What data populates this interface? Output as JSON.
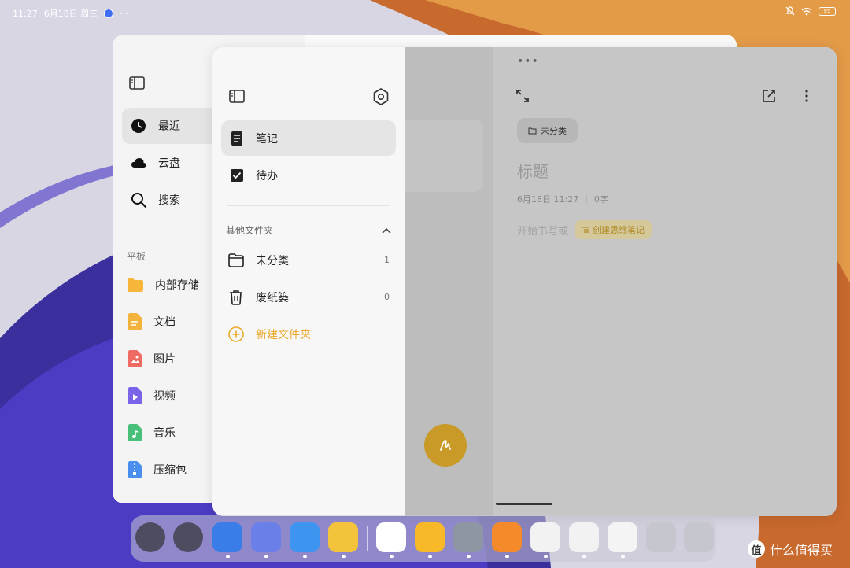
{
  "status_bar": {
    "time": "11:27",
    "date": "6月18日 周三",
    "more": "···",
    "battery": "95"
  },
  "files_app": {
    "nav": [
      {
        "label": "最近",
        "icon": "clock-icon",
        "active": true
      },
      {
        "label": "云盘",
        "icon": "cloud-icon",
        "active": false
      },
      {
        "label": "搜索",
        "icon": "search-icon",
        "active": false
      }
    ],
    "section_title": "平板",
    "types": [
      {
        "label": "内部存储",
        "icon": "folder-icon",
        "color": "#f5b63a"
      },
      {
        "label": "文档",
        "icon": "document-icon",
        "color": "#f3b23b"
      },
      {
        "label": "图片",
        "icon": "image-icon",
        "color": "#ef6a62"
      },
      {
        "label": "视频",
        "icon": "video-icon",
        "color": "#7a63e8"
      },
      {
        "label": "音乐",
        "icon": "music-icon",
        "color": "#49c07a"
      },
      {
        "label": "压缩包",
        "icon": "zip-icon",
        "color": "#4a8ef0"
      }
    ]
  },
  "notes_app": {
    "nav": [
      {
        "label": "笔记",
        "icon": "note-icon",
        "active": true
      },
      {
        "label": "待办",
        "icon": "checkbox-icon",
        "active": false
      }
    ],
    "other_folders_title": "其他文件夹",
    "folders": [
      {
        "label": "未分类",
        "count": "1",
        "icon": "folder-outline-icon"
      },
      {
        "label": "废纸篓",
        "count": "0",
        "icon": "trash-icon"
      }
    ],
    "new_folder_label": "新建文件夹",
    "accent_color": "#e9a92a",
    "editor": {
      "dots": "•••",
      "category_tag": "未分类",
      "title_placeholder": "标题",
      "date": "6月18日 11:27",
      "word_count": "0字",
      "start_hint": "开始书写或",
      "mindmap_chip": "创建思维笔记"
    }
  },
  "dock": {
    "apps": [
      {
        "name": "ai-assistant",
        "color": "#4d4d62"
      },
      {
        "name": "app-drawer",
        "color": "#4d4d62"
      },
      {
        "name": "browser",
        "color": "#3a7de9"
      },
      {
        "name": "gallery",
        "color": "#6a7fe8"
      },
      {
        "name": "mail",
        "color": "#3e95f0"
      },
      {
        "name": "notes",
        "color": "#f4c33c"
      },
      {
        "name": "wps-office",
        "color": "#ffffff"
      },
      {
        "name": "file-manager",
        "color": "#f7b928"
      },
      {
        "name": "settings",
        "color": "#8d96a2"
      },
      {
        "name": "mi-store",
        "color": "#f58a2b"
      },
      {
        "name": "game-1",
        "color": "#f2f2f2"
      },
      {
        "name": "game-2",
        "color": "#f2f2f2"
      },
      {
        "name": "pen-app",
        "color": "#f4f4f4"
      },
      {
        "name": "multitask",
        "color": "#c6c6ce"
      },
      {
        "name": "home",
        "color": "#c6c6ce"
      }
    ]
  },
  "watermark": {
    "badge": "值",
    "text": "什么值得买"
  }
}
